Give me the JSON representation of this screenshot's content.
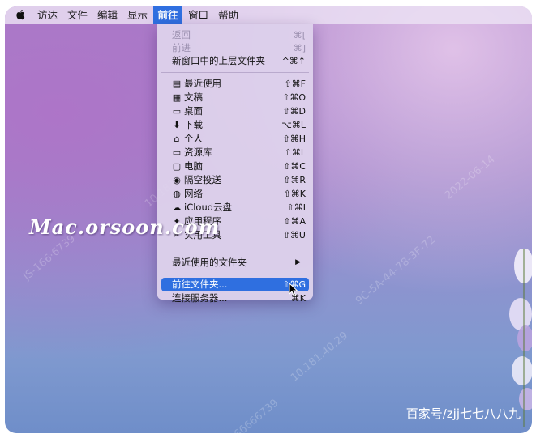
{
  "menubar": {
    "apple": "",
    "items": [
      "访达",
      "文件",
      "编辑",
      "显示",
      "前往",
      "窗口",
      "帮助"
    ],
    "active": "前往"
  },
  "go_menu": {
    "back": {
      "label": "返回",
      "shortcut": "⌘["
    },
    "forward": {
      "label": "前进",
      "shortcut": "⌘]"
    },
    "enclosing": {
      "label": "新窗口中的上层文件夹",
      "shortcut": "^⌘↑"
    },
    "places": [
      {
        "icon": "recents-icon",
        "label": "最近使用",
        "shortcut": "⇧⌘F"
      },
      {
        "icon": "documents-icon",
        "label": "文稿",
        "shortcut": "⇧⌘O"
      },
      {
        "icon": "desktop-icon",
        "label": "桌面",
        "shortcut": "⇧⌘D"
      },
      {
        "icon": "downloads-icon",
        "label": "下载",
        "shortcut": "⌥⌘L"
      },
      {
        "icon": "home-icon",
        "label": "个人",
        "shortcut": "⇧⌘H"
      },
      {
        "icon": "library-icon",
        "label": "资源库",
        "shortcut": "⇧⌘L"
      },
      {
        "icon": "computer-icon",
        "label": "电脑",
        "shortcut": "⇧⌘C"
      },
      {
        "icon": "airdrop-icon",
        "label": "隔空投送",
        "shortcut": "⇧⌘R"
      },
      {
        "icon": "network-icon",
        "label": "网络",
        "shortcut": "⇧⌘K"
      },
      {
        "icon": "icloud-icon",
        "label": "iCloud云盘",
        "shortcut": "⇧⌘I"
      },
      {
        "icon": "applications-icon",
        "label": "应用程序",
        "shortcut": "⇧⌘A"
      },
      {
        "icon": "utilities-icon",
        "label": "实用工具",
        "shortcut": "⇧⌘U"
      }
    ],
    "recent_folders": {
      "label": "最近使用的文件夹",
      "arrow": "▶"
    },
    "go_to_folder": {
      "label": "前往文件夹...",
      "shortcut": "⇧⌘G"
    },
    "connect_server": {
      "label": "连接服务器...",
      "shortcut": "⌘K"
    }
  },
  "watermark": {
    "logo": "Mac.orsoon.com",
    "credit": "百家号/zjj七七八八九"
  }
}
